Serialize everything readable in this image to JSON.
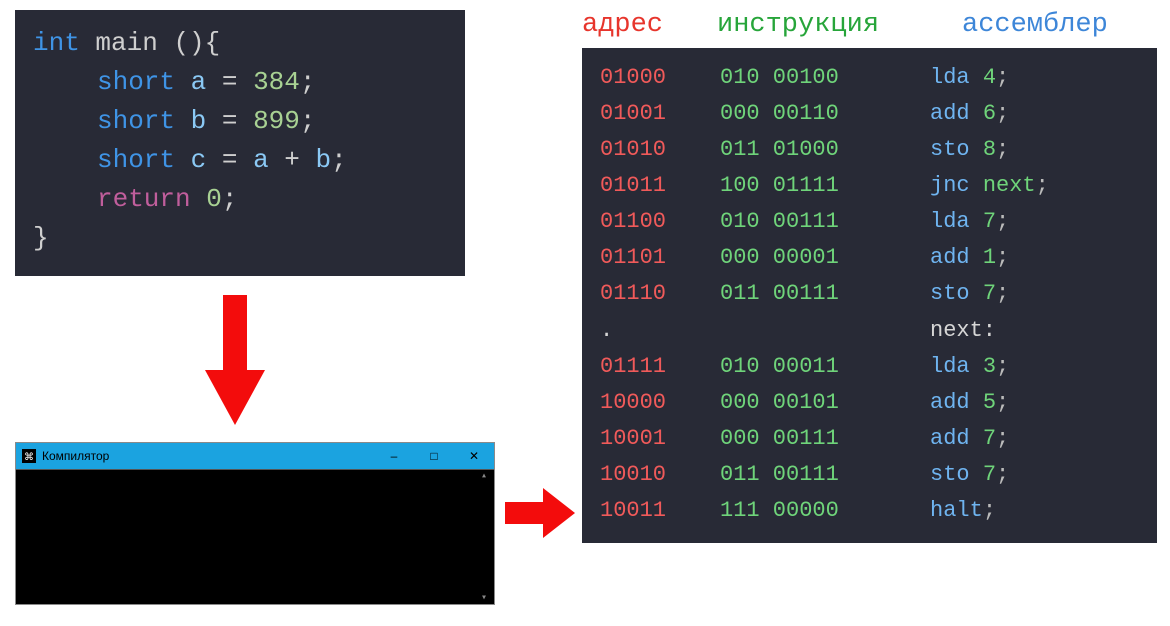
{
  "source": {
    "line1": {
      "type": "int",
      "name": "main",
      "parens": "()",
      "brace": "{"
    },
    "line2": {
      "type": "short",
      "var": "a",
      "eq": "=",
      "val": "384",
      "semi": ";"
    },
    "line3": {
      "type": "short",
      "var": "b",
      "eq": "=",
      "val": "899",
      "semi": ";"
    },
    "line4": {
      "type": "short",
      "var": "c",
      "eq": "=",
      "expr_a": "a",
      "plus": "+",
      "expr_b": "b",
      "semi": ";"
    },
    "line5": {
      "ret": "return",
      "val": "0",
      "semi": ";"
    },
    "line6": {
      "brace": "}"
    }
  },
  "compiler": {
    "title": "Компилятор",
    "minimize": "–",
    "maximize": "□",
    "close": "✕"
  },
  "asm": {
    "headers": {
      "addr": "адрес",
      "instr": "инструкция",
      "asm": "ассемблер"
    },
    "rows": [
      {
        "addr": "01000",
        "op1": "010",
        "op2": "00100",
        "mn": "lda",
        "arg": "4",
        "semi": ";"
      },
      {
        "addr": "01001",
        "op1": "000",
        "op2": "00110",
        "mn": "add",
        "arg": "6",
        "semi": ";"
      },
      {
        "addr": "01010",
        "op1": "011",
        "op2": "01000",
        "mn": "sto",
        "arg": "8",
        "semi": ";"
      },
      {
        "addr": "01011",
        "op1": "100",
        "op2": "01111",
        "mn": "jnc",
        "arg": "next",
        "semi": ";"
      },
      {
        "addr": "01100",
        "op1": "010",
        "op2": "00111",
        "mn": "lda",
        "arg": "7",
        "semi": ";"
      },
      {
        "addr": "01101",
        "op1": "000",
        "op2": "00001",
        "mn": "add",
        "arg": "1",
        "semi": ";"
      },
      {
        "addr": "01110",
        "op1": "011",
        "op2": "00111",
        "mn": "sto",
        "arg": "7",
        "semi": ";"
      },
      {
        "label": true,
        "addr": ".",
        "text": "next:"
      },
      {
        "addr": "01111",
        "op1": "010",
        "op2": "00011",
        "mn": "lda",
        "arg": "3",
        "semi": ";"
      },
      {
        "addr": "10000",
        "op1": "000",
        "op2": "00101",
        "mn": "add",
        "arg": "5",
        "semi": ";"
      },
      {
        "addr": "10001",
        "op1": "000",
        "op2": "00111",
        "mn": "add",
        "arg": "7",
        "semi": ";"
      },
      {
        "addr": "10010",
        "op1": "011",
        "op2": "00111",
        "mn": "sto",
        "arg": "7",
        "semi": ";"
      },
      {
        "addr": "10011",
        "op1": "111",
        "op2": "00000",
        "mn": "halt",
        "arg": "",
        "semi": ";"
      }
    ]
  }
}
